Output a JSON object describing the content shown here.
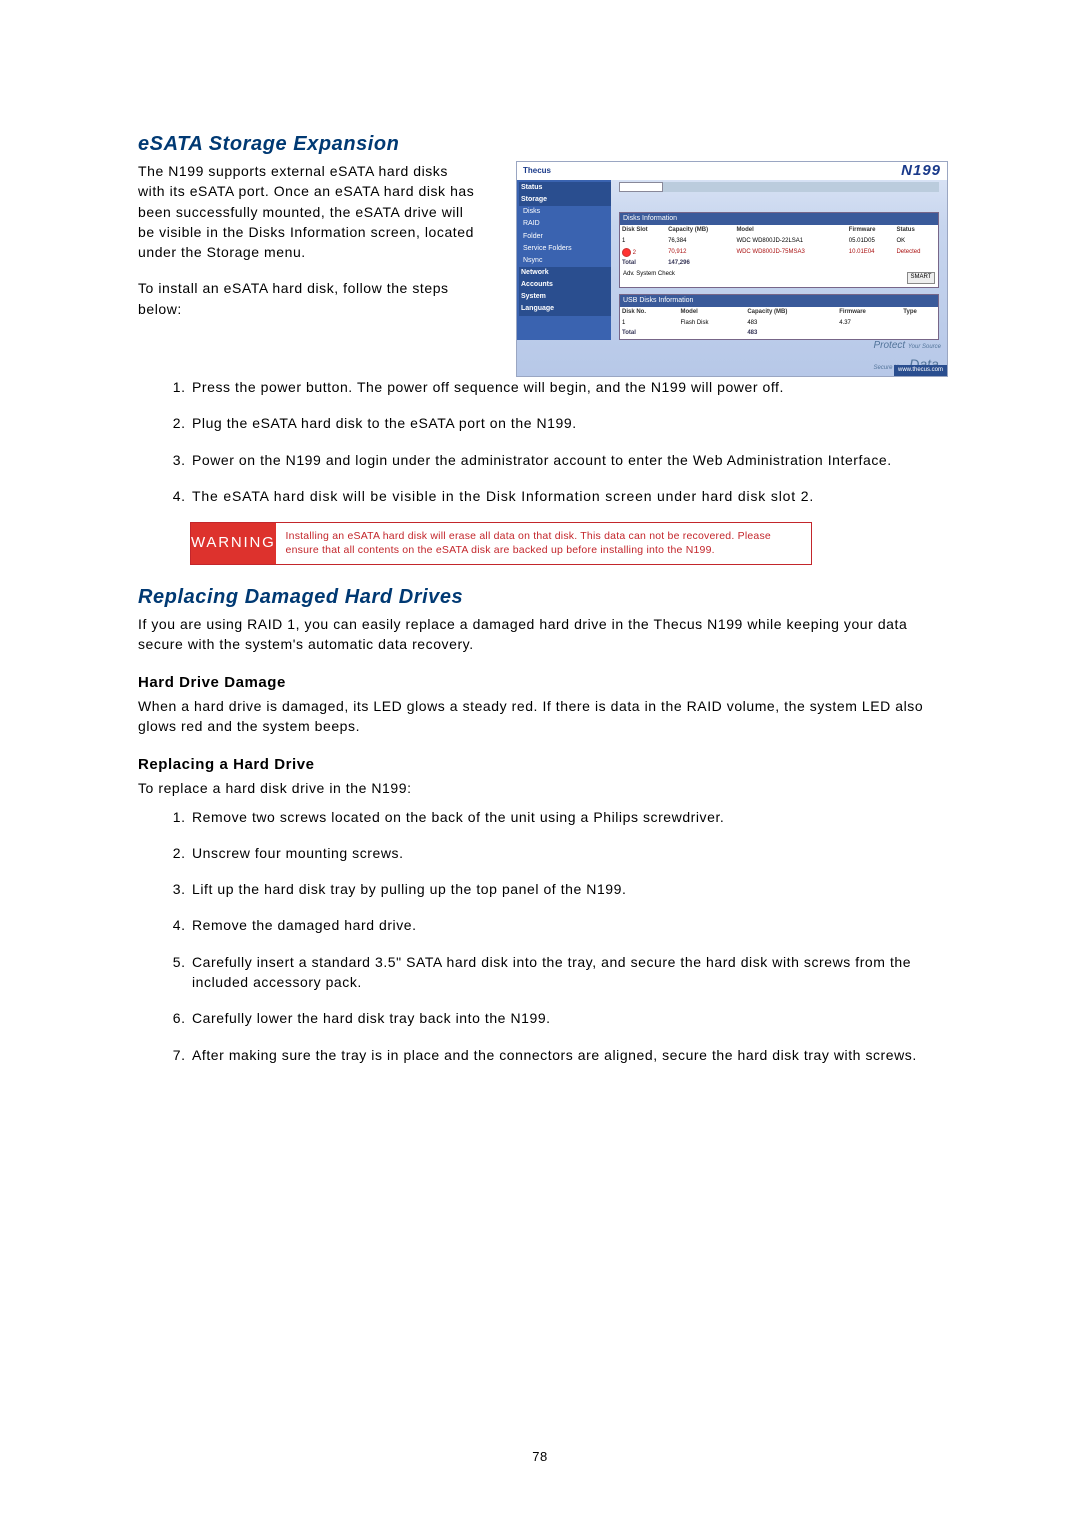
{
  "page_number": "78",
  "section1": {
    "heading": "eSATA Storage Expansion",
    "intro": "The N199 supports external eSATA hard disks with its eSATA port. Once an eSATA hard disk has been successfully mounted, the eSATA drive will be visible in the Disks Information screen, located under the Storage menu.",
    "pre_steps": "To install an eSATA hard disk, follow the steps below:",
    "steps": [
      "Press the power button. The power off sequence will begin, and the N199 will power off.",
      "Plug the eSATA hard disk to the eSATA port on the N199.",
      "Power on the N199 and login under the administrator account to enter the Web Administration Interface.",
      "The eSATA hard disk will be visible in the Disk Information screen under hard disk slot 2."
    ]
  },
  "warning": {
    "label": "WARNING",
    "text": "Installing an eSATA hard disk will erase all data on that disk. This data can not be recovered. Please ensure that all contents on the eSATA disk are backed up before installing into the N199."
  },
  "section2": {
    "heading": "Replacing Damaged Hard Drives",
    "intro": "If you are using RAID 1, you can easily replace a damaged hard drive in the Thecus N199 while keeping your data secure with the system's automatic data recovery."
  },
  "section3": {
    "heading": "Hard Drive Damage",
    "text": "When a hard drive is damaged, its LED glows a steady red. If there is data in the RAID volume, the system LED also glows red and the system beeps."
  },
  "section4": {
    "heading": "Replacing a Hard Drive",
    "intro": "To replace a hard disk drive in the N199:",
    "steps": [
      "Remove two screws located on the back of the unit using a Philips screwdriver.",
      "Unscrew four mounting screws.",
      "Lift up the hard disk tray by pulling up the top panel of the N199.",
      "Remove the damaged hard drive.",
      "Carefully insert a standard 3.5\" SATA hard disk into the tray, and secure the hard disk with screws from the included accessory pack.",
      "Carefully lower the hard disk tray back into the N199.",
      "After making sure the tray is in place and the connectors are aligned, secure the hard disk tray with screws."
    ]
  },
  "screenshot": {
    "brand_logo": "Thecus",
    "brand_model": "N199",
    "nav": {
      "groups": [
        {
          "label": "Status",
          "items": []
        },
        {
          "label": "Storage",
          "items": [
            "Disks",
            "RAID",
            "Folder",
            "Service Folders",
            "Nsync"
          ]
        },
        {
          "label": "Network",
          "items": []
        },
        {
          "label": "Accounts",
          "items": []
        },
        {
          "label": "System",
          "items": []
        },
        {
          "label": "Language",
          "items": []
        }
      ]
    },
    "panel1": {
      "title": "Disks Information",
      "headers": [
        "Disk Slot",
        "Capacity (MB)",
        "Model",
        "Firmware",
        "Status"
      ],
      "rows": [
        {
          "slot": "1",
          "cap": "76,384",
          "model": "WDC WD800JD-22LSA1",
          "fw": "05.01D05",
          "status": "OK"
        },
        {
          "slot": "2",
          "cap": "70,912",
          "model": "WDC WD800JD-75MSA3",
          "fw": "10.01E04",
          "status": "Detected",
          "warn": true
        }
      ],
      "total_label": "Total",
      "total_value": "147,296",
      "smart_label": "Adv. System Check",
      "smart_button": "SMART"
    },
    "panel2": {
      "title": "USB Disks Information",
      "headers": [
        "Disk No.",
        "Model",
        "Capacity (MB)",
        "Firmware",
        "Type"
      ],
      "rows": [
        {
          "no": "1",
          "model": "Flash Disk",
          "cap": "483",
          "fw": "4.37",
          "type": ""
        }
      ],
      "total_label": "Total",
      "total_value": "483"
    },
    "footer_brand": "Protect",
    "footer_sub1": "Your Source",
    "footer_sub2": "Secure Your",
    "footer_brand2": "Data",
    "footer_url": "www.thecus.com"
  }
}
